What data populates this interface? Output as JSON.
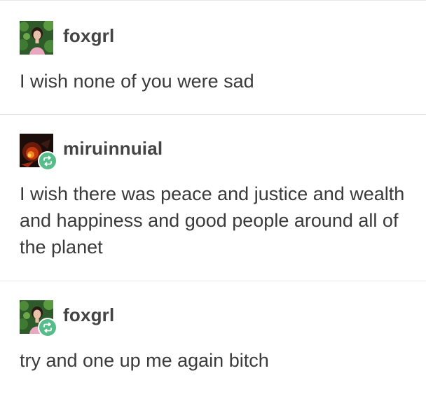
{
  "thread": {
    "posts": [
      {
        "username": "foxgrl",
        "avatar_icon": "user-avatar-portrait",
        "reblog": false,
        "text": "I wish none of you were sad"
      },
      {
        "username": "miruinnuial",
        "avatar_icon": "user-avatar-fire",
        "reblog": true,
        "text": "I wish there was peace and justice and wealth and happiness and good people around all of the planet"
      },
      {
        "username": "foxgrl",
        "avatar_icon": "user-avatar-portrait",
        "reblog": true,
        "text": "try and one up me again bitch"
      }
    ]
  },
  "colors": {
    "reblog_badge": "#56bc8a",
    "divider": "#e6e6e6",
    "text": "#3a3a3a",
    "username": "#444444"
  }
}
